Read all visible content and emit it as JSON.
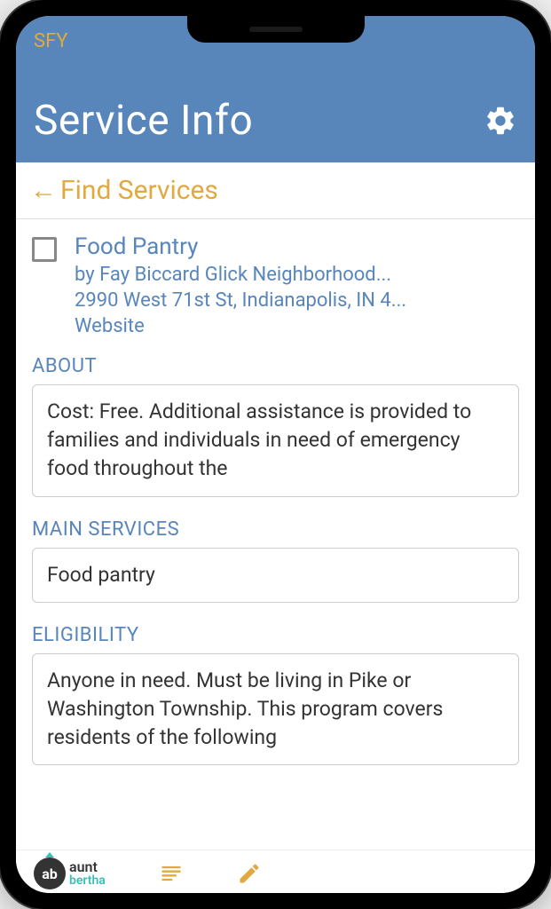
{
  "app_badge": "SFY",
  "header": {
    "title": "Service Info"
  },
  "back": {
    "label": "Find Services"
  },
  "service": {
    "title": "Food Pantry",
    "provider": "by Fay Biccard Glick Neighborhood...",
    "address": "2990 West 71st St, Indianapolis, IN 4...",
    "website_label": "Website"
  },
  "sections": {
    "about": {
      "label": "ABOUT",
      "text": "Cost: Free. Additional assistance is provided to families and individuals in need of emergency food throughout the"
    },
    "main_services": {
      "label": "MAIN SERVICES",
      "text": "Food pantry"
    },
    "eligibility": {
      "label": "ELIGIBILITY",
      "text": "Anyone in need. Must be living in Pike or Washington Township. This program covers residents of the following"
    }
  },
  "footer": {
    "logo_ab": "ab",
    "logo_aunt": "aunt",
    "logo_bertha": "bertha"
  }
}
